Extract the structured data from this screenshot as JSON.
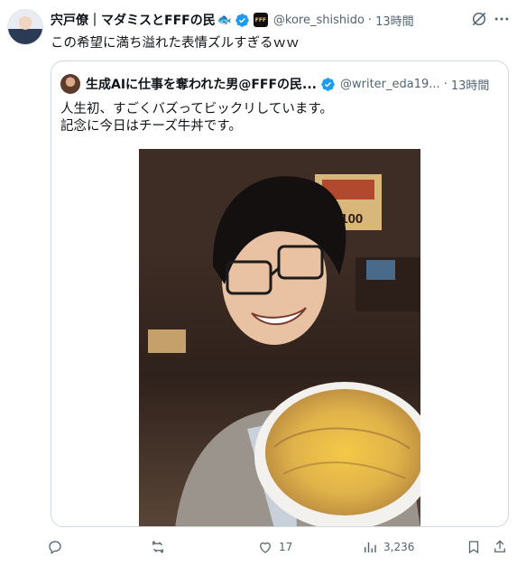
{
  "post": {
    "author_name": "宍戸僚｜マダミスとFFFの民",
    "author_emoji": "🐟",
    "org_badge_text": "FFF",
    "handle": "@kore_shishido",
    "separator": "·",
    "time": "13時間",
    "text": "この希望に満ち溢れた表情ズルすぎるｗｗ"
  },
  "quote": {
    "author_name": "生成AIに仕事を奪われた男@FFFの民...",
    "handle": "@writer_eda19...",
    "separator": "·",
    "time": "13時間",
    "text_lines": [
      "人生初、すごくバズってビックリしています。",
      "記念に今日はチーズ牛丼です。"
    ],
    "poster_price": "1100"
  },
  "actions": {
    "reply_count": "",
    "repost_count": "",
    "like_count": "17",
    "views_count": "3,236"
  },
  "colors": {
    "verified": "#1d9bf0",
    "text_primary": "#0f1419",
    "text_secondary": "#536471",
    "border": "#cfd9de"
  },
  "icons": [
    "verified-badge-icon",
    "grok-icon",
    "more-icon",
    "reply-icon",
    "repost-icon",
    "like-icon",
    "views-icon",
    "bookmark-icon",
    "share-icon"
  ]
}
